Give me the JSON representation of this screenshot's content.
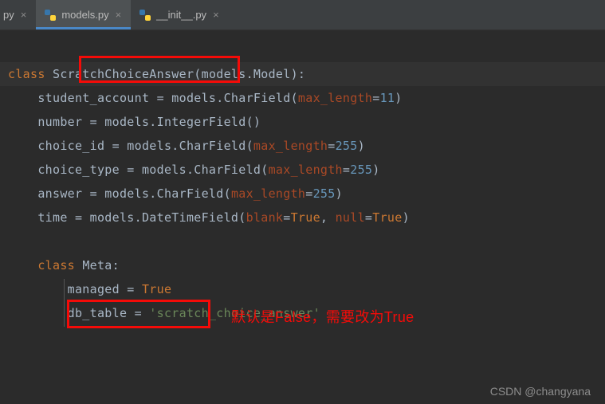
{
  "tabs": {
    "partial": {
      "label": "py"
    },
    "active": {
      "label": "models.py"
    },
    "other": {
      "label": "__init__.py"
    }
  },
  "code": {
    "l1_kw": "class",
    "l1_name": " ScratchChoiceAnswer",
    "l1_rest": "(models.Model):",
    "l2a": "    student_account = models.CharField(",
    "l2p": "max_length",
    "l2eq": "=",
    "l2n": "11",
    "l2z": ")",
    "l3": "    number = models.IntegerField()",
    "l4a": "    choice_id = models.CharField(",
    "l4p": "max_length",
    "l4eq": "=",
    "l4n": "255",
    "l4z": ")",
    "l5a": "    choice_type = models.CharField(",
    "l5p": "max_length",
    "l5eq": "=",
    "l5n": "255",
    "l5z": ")",
    "l6a": "    answer = models.CharField(",
    "l6p": "max_length",
    "l6eq": "=",
    "l6n": "255",
    "l6z": ")",
    "l7a": "    time = models.DateTimeField(",
    "l7p1": "blank",
    "l7eq1": "=",
    "l7v1": "True",
    "l7c": ", ",
    "l7p2": "null",
    "l7eq2": "=",
    "l7v2": "True",
    "l7z": ")",
    "l9kw": "class",
    "l9name": " Meta",
    "l9z": ":",
    "l10a": "        managed = ",
    "l10v": "True",
    "l11a": "        db_table = ",
    "l11s": "'scratch_choice_answer'"
  },
  "annotation": "默认是False，需要改为True",
  "watermark": "CSDN @changyana"
}
